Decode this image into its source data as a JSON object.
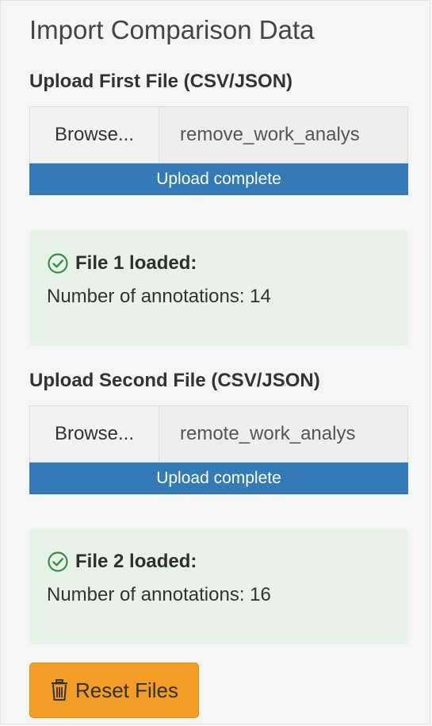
{
  "panel": {
    "title": "Import Comparison Data"
  },
  "file1": {
    "label": "Upload First File (CSV/JSON)",
    "browse_label": "Browse...",
    "filename": "remove_work_analys",
    "progress_text": "Upload complete",
    "progress_fraction": 1.0,
    "status_title": "File 1 loaded:",
    "status_detail": "Number of annotations: 14"
  },
  "file2": {
    "label": "Upload Second File (CSV/JSON)",
    "browse_label": "Browse...",
    "filename": "remote_work_analys",
    "progress_text": "Upload complete",
    "progress_fraction": 1.0,
    "status_title": "File 2 loaded:",
    "status_detail": "Number of annotations: 16"
  },
  "reset_button": {
    "label": "Reset Files",
    "icon": "trash-icon"
  },
  "colors": {
    "progress": "#337ab7",
    "success_bg": "#e7f3e7",
    "reset_button": "#f39c26"
  }
}
